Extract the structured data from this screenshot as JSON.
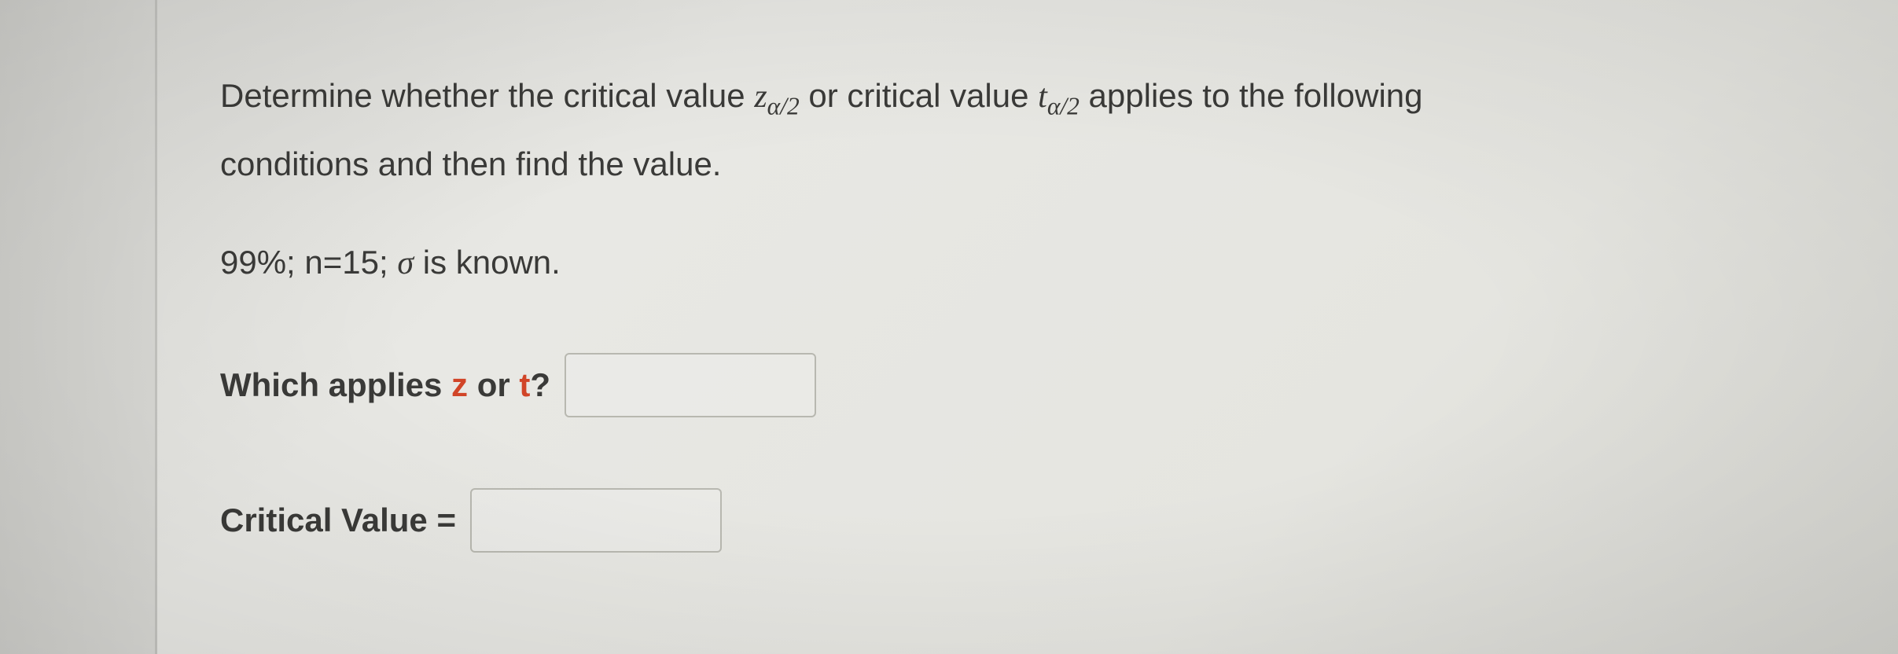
{
  "question": {
    "part1_before_z": "Determine whether the critical value ",
    "z_symbol": "z",
    "z_sub": "α/2",
    "part1_mid": " or critical value ",
    "t_symbol": "t",
    "t_sub": "α/2",
    "part1_after": " applies to the following",
    "part2": "conditions and then find the value."
  },
  "conditions": {
    "confidence": "99%; n=15; ",
    "sigma": "σ",
    "sigma_after": " is known."
  },
  "prompt1": {
    "before_z": "Which applies ",
    "z": "z",
    "between": " or ",
    "t": "t",
    "after": "?"
  },
  "prompt2": {
    "label": "Critical Value ="
  },
  "inputs": {
    "which_value": "",
    "critical_value": ""
  }
}
